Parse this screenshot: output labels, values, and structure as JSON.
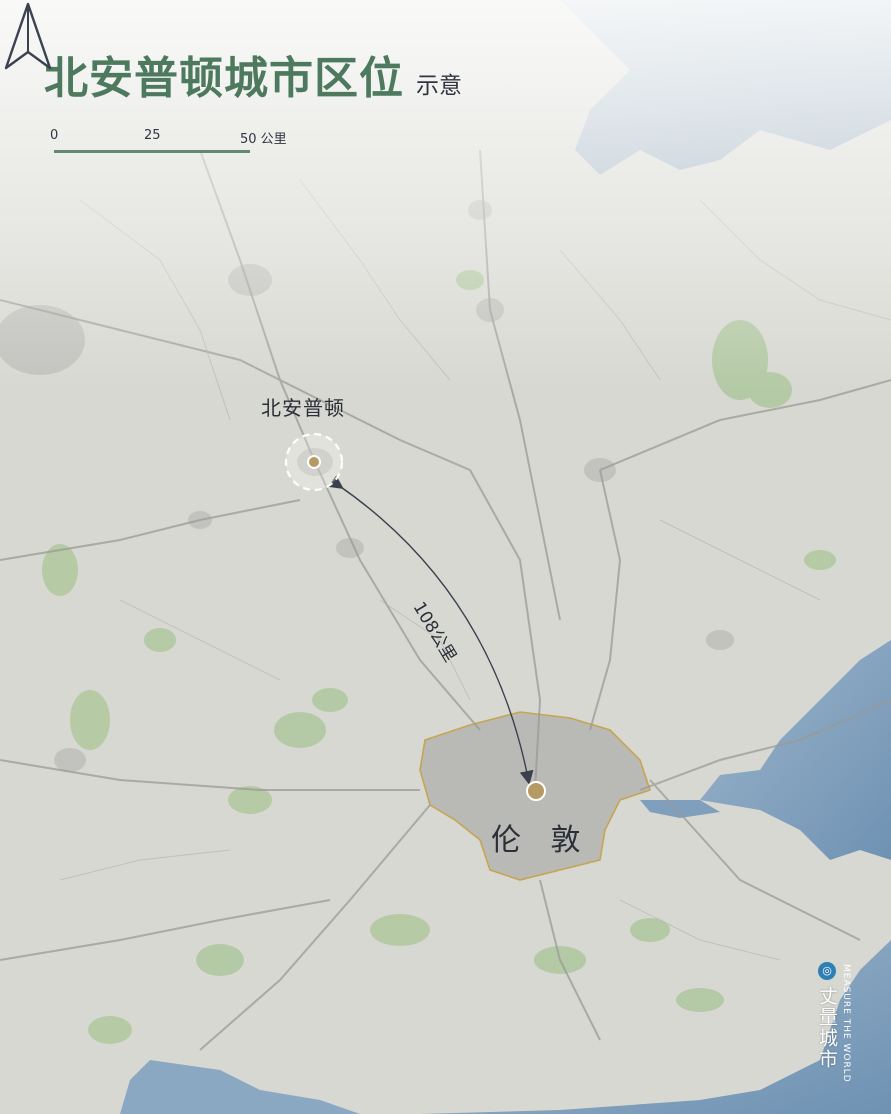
{
  "title": {
    "main": "北安普顿城市区位",
    "sub": "示意"
  },
  "scale_bar": {
    "ticks": [
      "0",
      "25",
      "50 公里"
    ]
  },
  "labels": {
    "origin_city": "北安普顿",
    "destination_city": "伦 敦",
    "distance": "108公里"
  },
  "branding": {
    "chinese": "丈量城市",
    "english": "MEASURE THE WORLD"
  },
  "icons": {
    "north_arrow": "north-arrow-icon",
    "brand_logo": "globe-logo-icon"
  },
  "colors": {
    "title_green": "#4d7a5e",
    "land": "#d8d8d2",
    "sea": "#7f9fbd",
    "greenery": "#a9c596",
    "marker": "#b59b63",
    "london_boundary": "#c6a552"
  }
}
